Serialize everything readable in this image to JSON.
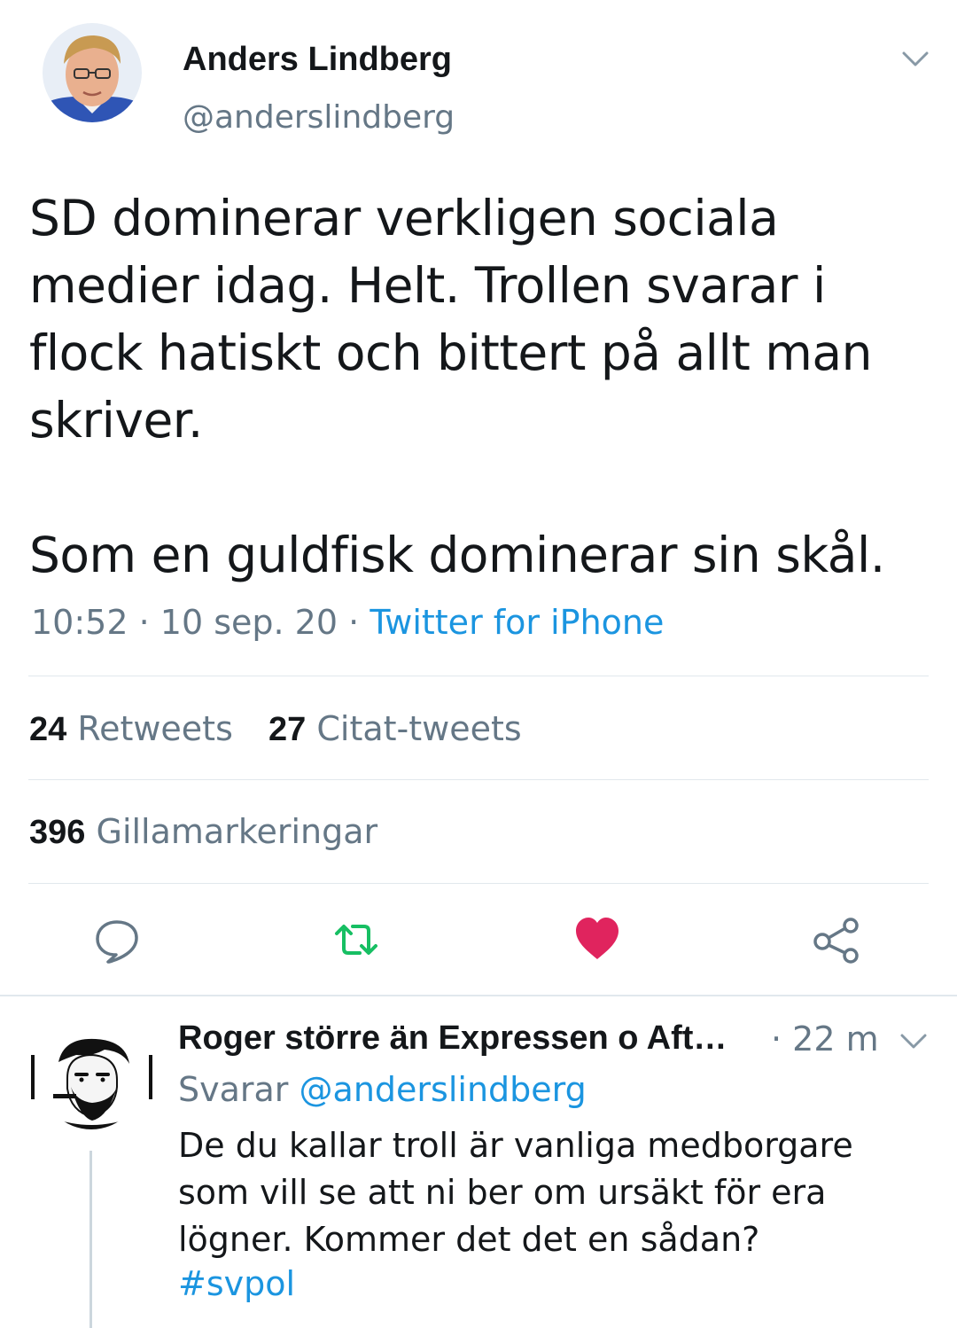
{
  "tweet": {
    "author_name": "Anders Lindberg",
    "author_handle": "@anderslindberg",
    "body": "SD dominerar verkligen sociala medier idag. Helt. Trollen svarar i flock hatiskt och bittert på allt man skriver.\n\nSom en guldfisk dominerar sin skål.",
    "time": "10:52",
    "date": "10 sep. 20",
    "separator": "·",
    "source": "Twitter for iPhone"
  },
  "stats": {
    "retweets_count": "24",
    "retweets_label": "Retweets",
    "quotes_count": "27",
    "quotes_label": "Citat-tweets",
    "likes_count": "396",
    "likes_label": "Gillamarkeringar"
  },
  "actions": {
    "reply_icon": "comment-icon",
    "retweet_icon": "retweet-icon",
    "like_icon": "heart-icon",
    "share_icon": "share-icon",
    "retweet_color": "#17bf63",
    "like_color": "#e0245e"
  },
  "reply": {
    "author_name": "Roger större än Expressen o Aft…",
    "time": "· 22 m",
    "replying_label": "Svarar",
    "replying_to": "@anderslindberg",
    "text": "De du kallar troll är vanliga medborgare som vill se att ni ber om ursäkt för era lögner. Kommer det det en sådan?",
    "hashtag": "#svpol"
  }
}
